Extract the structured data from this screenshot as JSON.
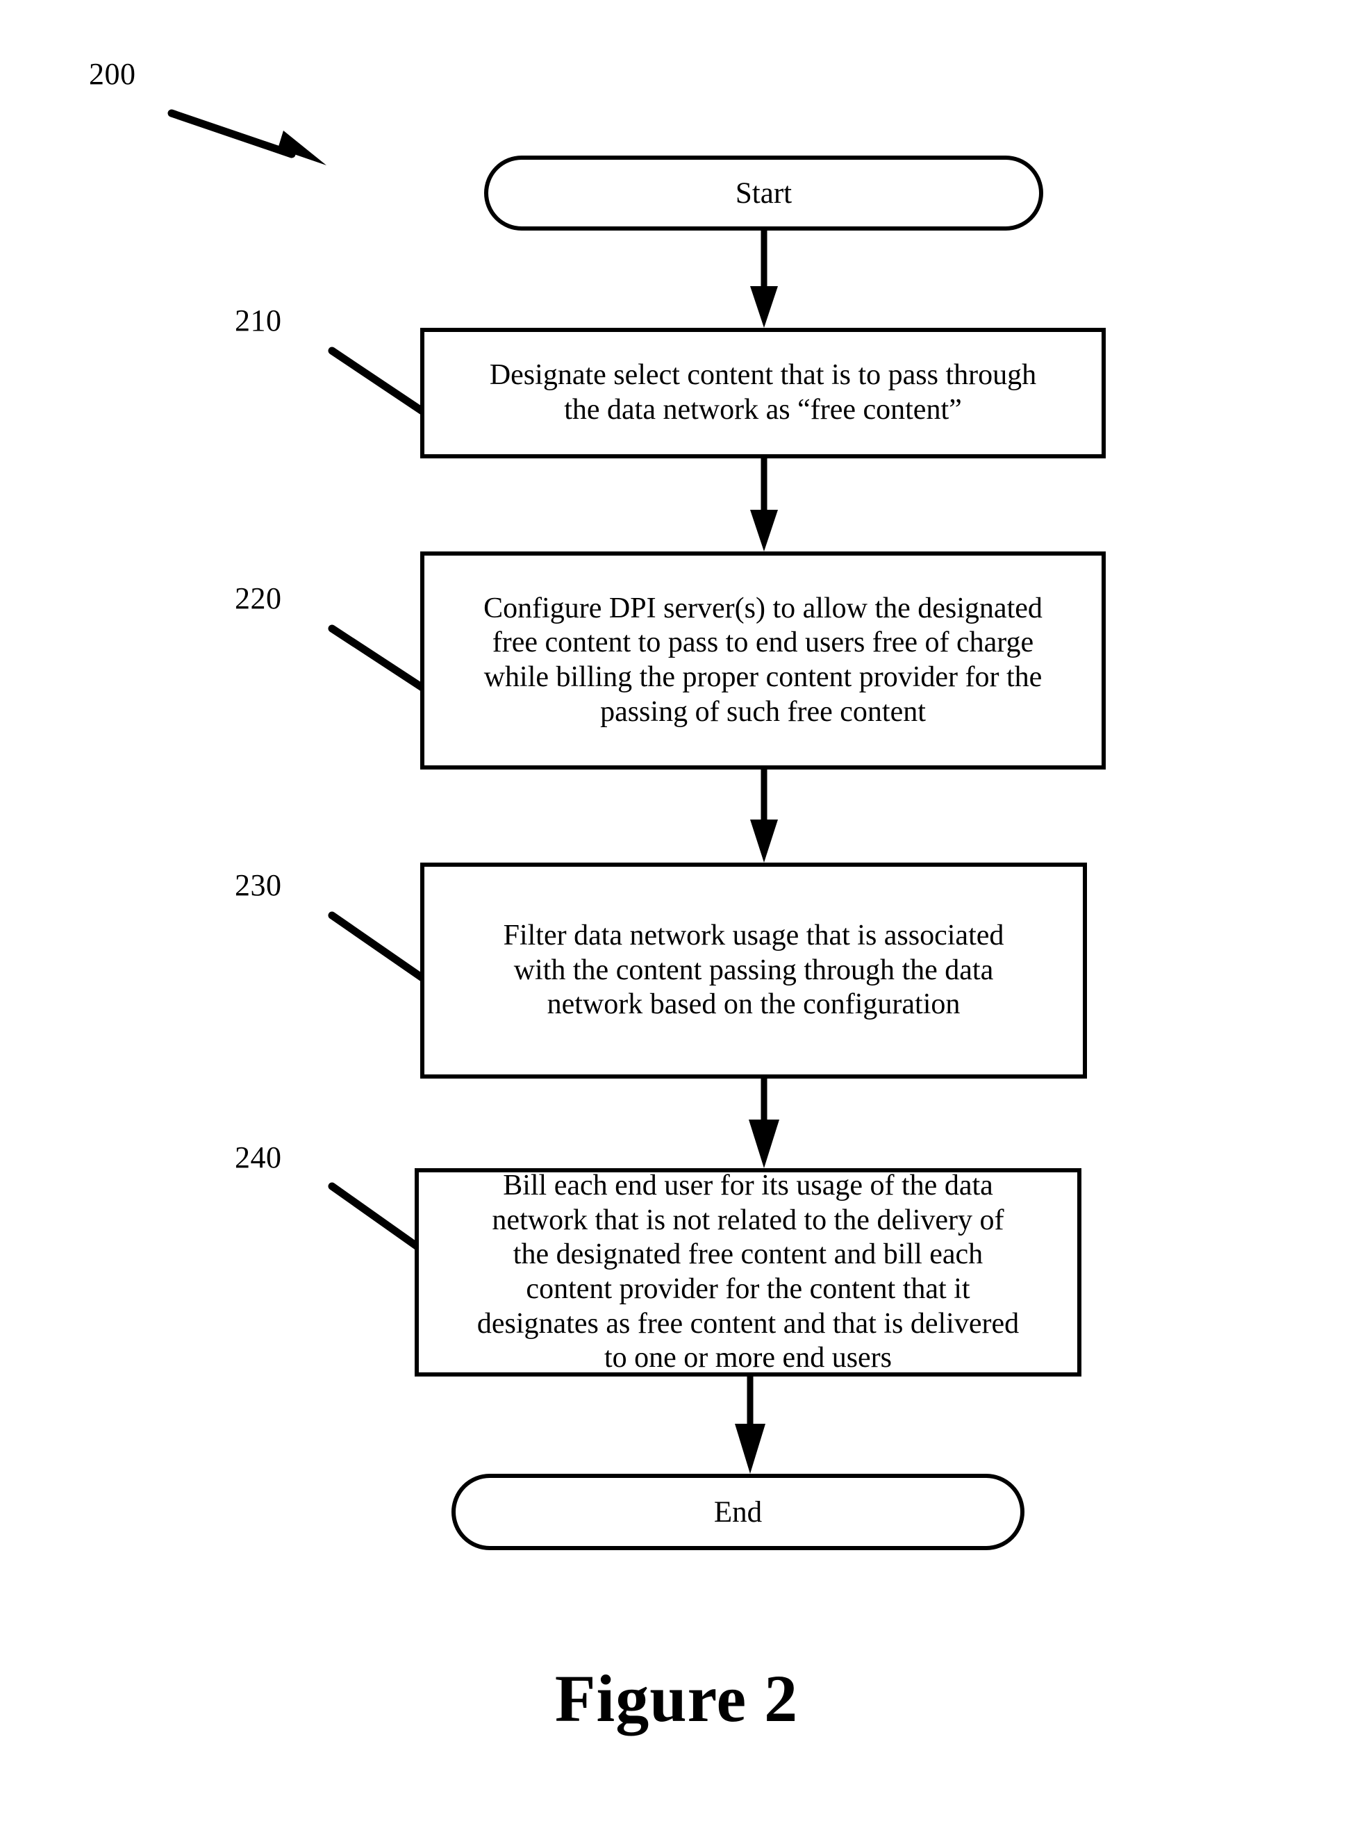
{
  "figure": {
    "caption": "Figure 2",
    "diagram_number": "200"
  },
  "nodes": {
    "start": {
      "label": "Start",
      "shape": "terminator"
    },
    "step210": {
      "ref": "210",
      "label": "Designate select content that is to pass through\nthe data network as “free content”",
      "shape": "process"
    },
    "step220": {
      "ref": "220",
      "label": "Configure DPI server(s) to allow the designated\nfree content to pass to end users free of charge\nwhile billing the proper content provider for the\npassing of such free content",
      "shape": "process"
    },
    "step230": {
      "ref": "230",
      "label": "Filter data network usage that is associated\nwith the content passing through the data\nnetwork based on the configuration",
      "shape": "process"
    },
    "step240": {
      "ref": "240",
      "label": "Bill each end user for its usage of the data\nnetwork that is not related to the delivery of\nthe designated free content and bill each\ncontent provider for the content that it\ndesignates as free content and that is delivered\nto one or more end users",
      "shape": "process"
    },
    "end": {
      "label": "End",
      "shape": "terminator"
    }
  },
  "colors": {
    "stroke": "#000000",
    "background": "#ffffff"
  }
}
